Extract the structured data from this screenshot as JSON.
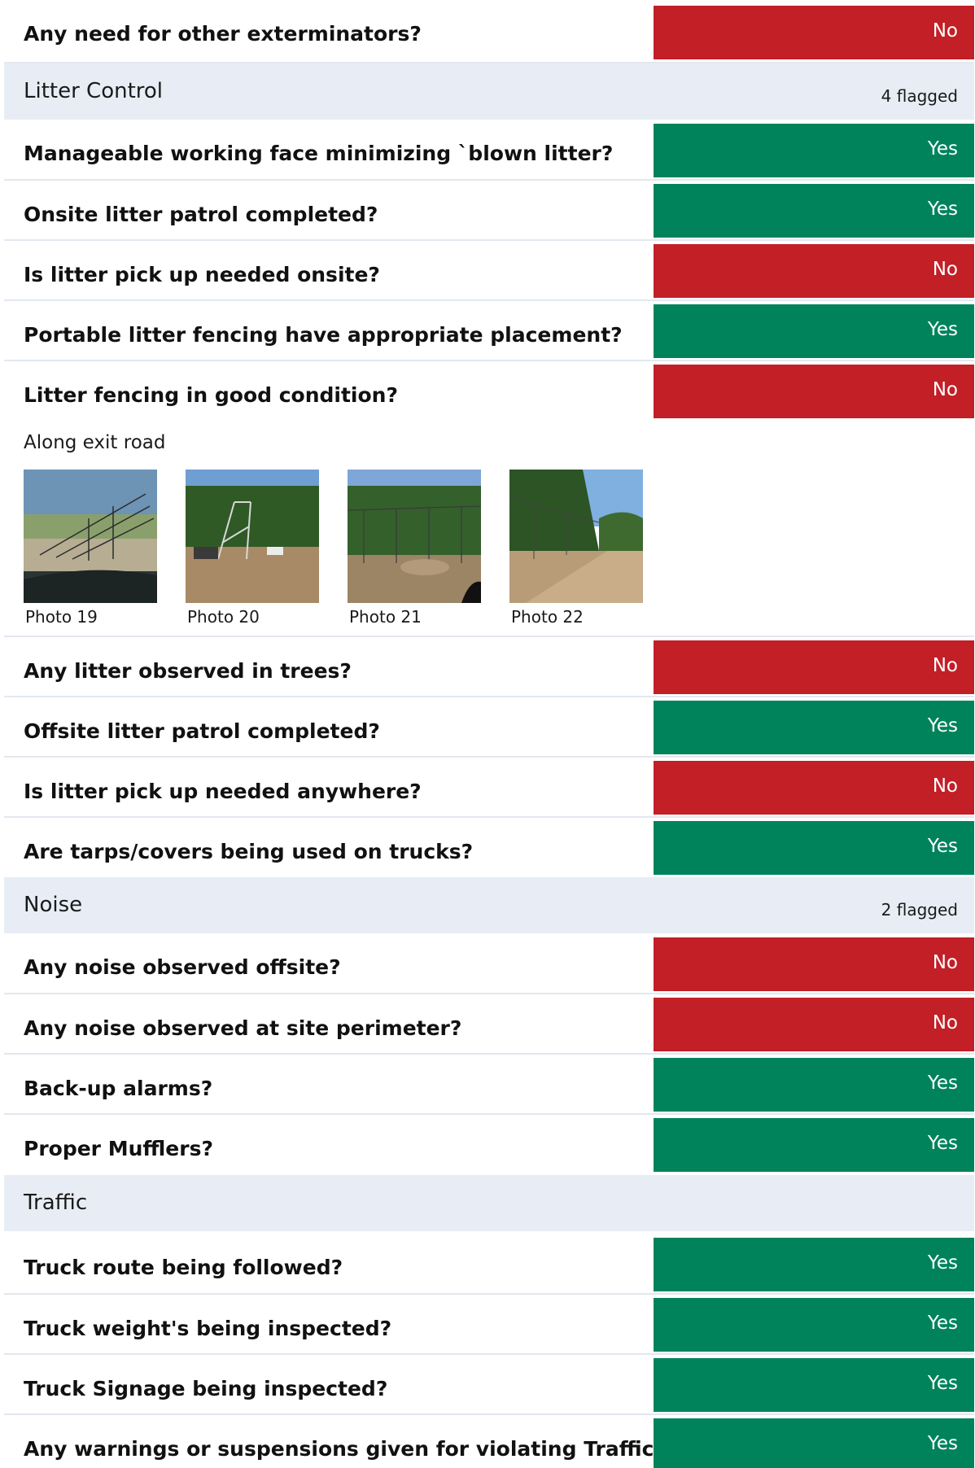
{
  "colors": {
    "no": "#c21f27",
    "yes": "#00835b",
    "section_bg": "#e8edf5"
  },
  "rows": [
    {
      "question": "Any need for other exterminators?",
      "answer": "No"
    },
    {
      "question": "Manageable working face minimizing `blown litter?",
      "answer": "Yes"
    },
    {
      "question": "Onsite litter patrol completed?",
      "answer": "Yes"
    },
    {
      "question": "Is litter pick up needed onsite?",
      "answer": "No"
    },
    {
      "question": "Portable litter fencing have appropriate placement?",
      "answer": "Yes"
    },
    {
      "question": "Litter fencing in good condition?",
      "answer": "No"
    },
    {
      "question": "Any litter observed in trees?",
      "answer": "No"
    },
    {
      "question": "Offsite litter patrol completed?",
      "answer": "Yes"
    },
    {
      "question": "Is litter pick up needed anywhere?",
      "answer": "No"
    },
    {
      "question": "Are tarps/covers being used on trucks?",
      "answer": "Yes"
    },
    {
      "question": "Any noise observed offsite?",
      "answer": "No"
    },
    {
      "question": "Any noise observed at site perimeter?",
      "answer": "No"
    },
    {
      "question": "Back-up alarms?",
      "answer": "Yes"
    },
    {
      "question": "Proper Mufflers?",
      "answer": "Yes"
    },
    {
      "question": "Truck route being followed?",
      "answer": "Yes"
    },
    {
      "question": "Truck weight's being inspected?",
      "answer": "Yes"
    },
    {
      "question": "Truck Signage being inspected?",
      "answer": "Yes"
    },
    {
      "question": "Any warnings or suspensions given for violating Traffic",
      "answer": "Yes"
    }
  ],
  "sections": [
    {
      "title": "Litter Control",
      "flagged": "4 flagged"
    },
    {
      "title": "Noise",
      "flagged": "2 flagged"
    },
    {
      "title": "Traffic",
      "flagged": ""
    }
  ],
  "note": "Along exit road",
  "photos": [
    {
      "caption": "Photo 19",
      "icon": "litter-fence-photo"
    },
    {
      "caption": "Photo 20",
      "icon": "litter-fence-photo"
    },
    {
      "caption": "Photo 21",
      "icon": "litter-fence-photo"
    },
    {
      "caption": "Photo 22",
      "icon": "litter-fence-photo"
    }
  ]
}
